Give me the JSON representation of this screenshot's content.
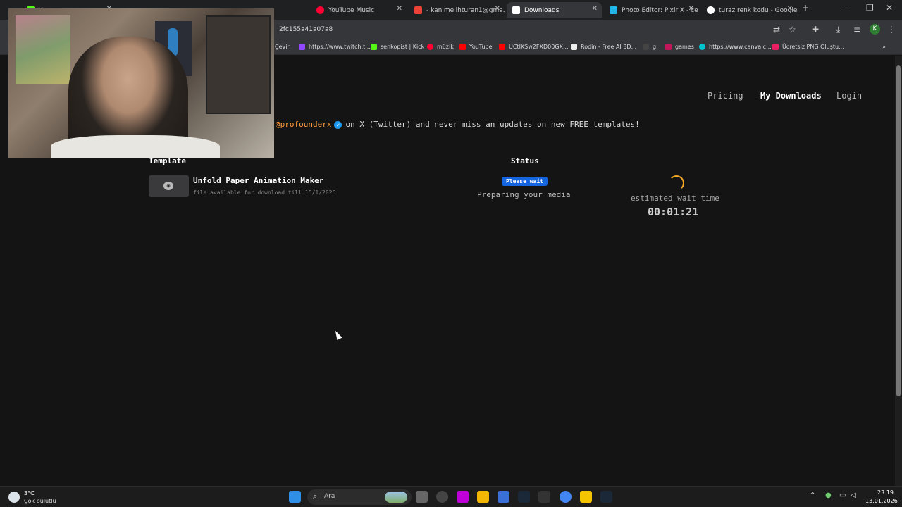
{
  "browser": {
    "tabs": [
      {
        "label": "Y..."
      },
      {
        "label": "YouTube Music"
      },
      {
        "label": "- kanimelihturan1@gma..."
      },
      {
        "label": "Downloads"
      },
      {
        "label": "Photo Editor: Pixlr X - çev..."
      },
      {
        "label": "turaz renk kodu - Google..."
      }
    ],
    "address_fragment": "2fc155a41a07a8",
    "profile_initial": "K",
    "bookmarks": [
      {
        "label": "Çevir"
      },
      {
        "label": "https://www.twitch.t..."
      },
      {
        "label": "senkopist | Kick"
      },
      {
        "label": "müzik"
      },
      {
        "label": "YouTube"
      },
      {
        "label": "UCtIKSw2FXD00GX..."
      },
      {
        "label": "Rodin - Free AI 3D..."
      },
      {
        "label": "g"
      },
      {
        "label": "games"
      },
      {
        "label": "https://www.canva.c..."
      },
      {
        "label": "Ücretsiz PNG Oluştu..."
      }
    ]
  },
  "site": {
    "nav": {
      "pricing": "Pricing",
      "downloads": "My Downloads",
      "login": "Login"
    },
    "promo": {
      "handle": "@profounderx",
      "text": "on X (Twitter) and never miss an updates on new FREE templates!"
    },
    "columns": {
      "template": "Template",
      "status": "Status"
    },
    "item": {
      "name": "Unfold Paper Animation Maker",
      "availability": "file available for download till 15/1/2026",
      "badge": "Please wait",
      "status": "Preparing your media",
      "estimate_label": "estimated wait time",
      "estimate_time": "00:01:21"
    }
  },
  "taskbar": {
    "temperature": "3°C",
    "weather": "Çok bulutlu",
    "search": "Ara",
    "time": "23:19",
    "date": "13.01.2026"
  },
  "colors": {
    "accent": "#ff9a3c",
    "badge": "#1565e0",
    "spinner": "#f5a623"
  }
}
